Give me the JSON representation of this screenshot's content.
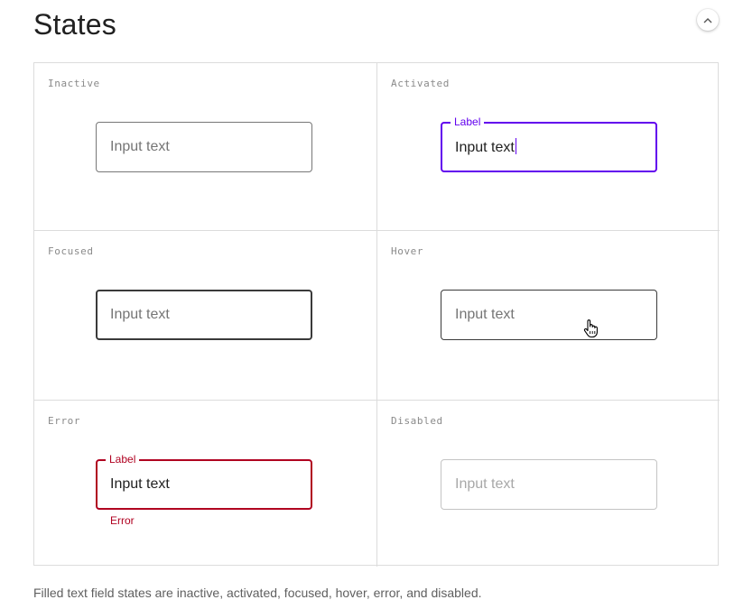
{
  "header": {
    "title": "States",
    "collapse_icon": "chevron-up-icon"
  },
  "states": {
    "inactive": {
      "name": "Inactive",
      "value": "Input text"
    },
    "activated": {
      "name": "Activated",
      "label": "Label",
      "value": "Input text",
      "accent": "#6200ee"
    },
    "focused": {
      "name": "Focused",
      "value": "Input text"
    },
    "hover": {
      "name": "Hover",
      "value": "Input text",
      "pointer_icon": "hand-pointer-icon"
    },
    "error": {
      "name": "Error",
      "label": "Label",
      "value": "Input text",
      "helper": "Error",
      "accent": "#b00020"
    },
    "disabled": {
      "name": "Disabled",
      "value": "Input text"
    }
  },
  "caption": "Filled text field states are inactive, activated, focused, hover, error, and disabled."
}
